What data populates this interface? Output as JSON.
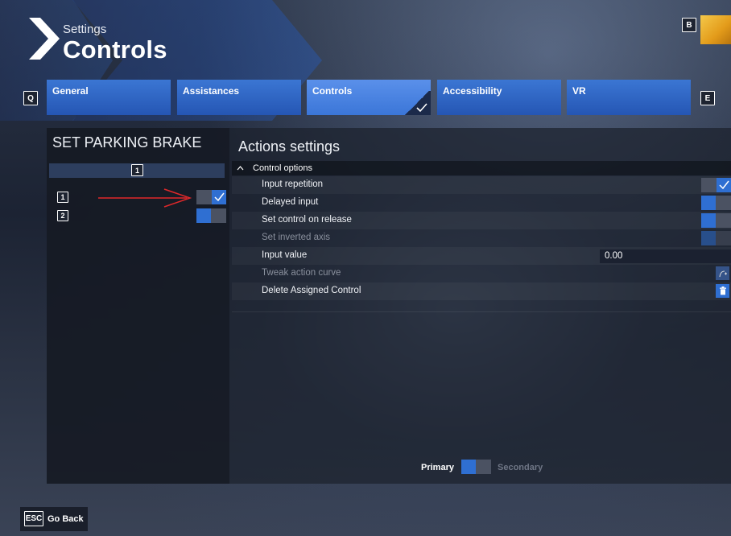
{
  "header": {
    "subtitle": "Settings",
    "title": "Controls",
    "right_key": "B"
  },
  "tabs": {
    "left_key": "Q",
    "right_key": "E",
    "items": [
      {
        "label": "General"
      },
      {
        "label": "Assistances"
      },
      {
        "label": "Controls",
        "active": true
      },
      {
        "label": "Accessibility"
      },
      {
        "label": "VR"
      }
    ]
  },
  "left_panel": {
    "title": "SET PARKING BRAKE",
    "column_key": "1",
    "rows": [
      {
        "key": "1",
        "toggle": "on"
      },
      {
        "key": "2",
        "toggle": "off"
      }
    ]
  },
  "right_panel": {
    "title": "Actions settings",
    "section": "Control options",
    "options": [
      {
        "label": "Input repetition",
        "type": "toggle",
        "state": "on",
        "enabled": true
      },
      {
        "label": "Delayed input",
        "type": "toggle",
        "state": "off",
        "enabled": true
      },
      {
        "label": "Set control on release",
        "type": "toggle",
        "state": "off",
        "enabled": true
      },
      {
        "label": "Set inverted axis",
        "type": "toggle",
        "state": "off",
        "enabled": false
      },
      {
        "label": "Input value",
        "type": "value",
        "value": "0.00",
        "enabled": true
      },
      {
        "label": "Tweak action curve",
        "type": "icon",
        "icon": "curve-icon",
        "enabled": false
      },
      {
        "label": "Delete Assigned Control",
        "type": "icon",
        "icon": "trash-icon",
        "enabled": true
      }
    ],
    "footer": {
      "primary": "Primary",
      "secondary": "Secondary",
      "state": "primary"
    }
  },
  "footer": {
    "back_key": "ESC",
    "back_label": "Go Back"
  },
  "colors": {
    "accent": "#2f6fd2",
    "tab": "#2f63c2",
    "panel": "#161a24",
    "annotation": "#e0282a"
  }
}
